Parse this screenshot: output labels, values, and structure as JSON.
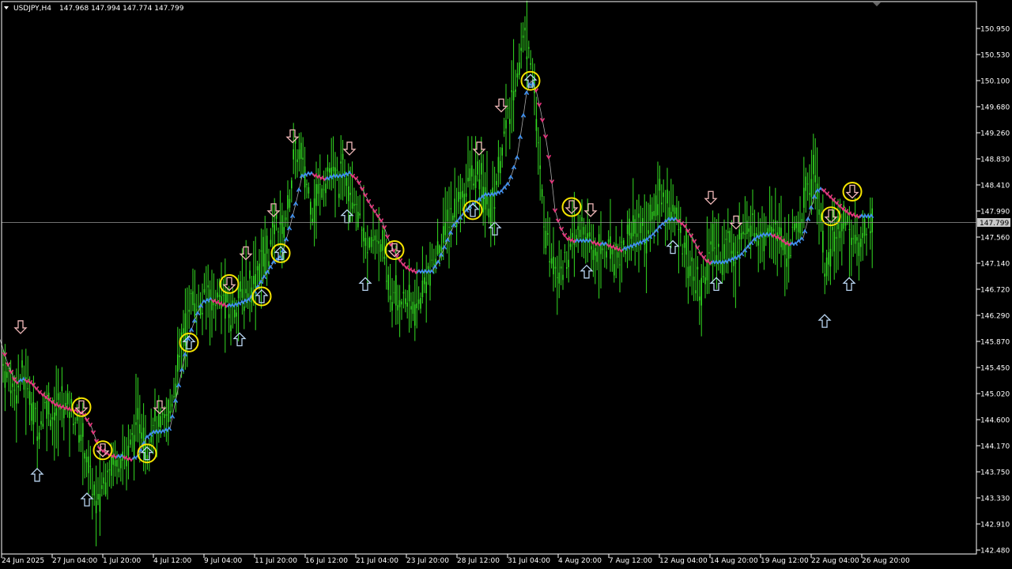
{
  "header": {
    "symbol": "USDJPY,H4",
    "ohlc": "147.968 147.994 147.774 147.799"
  },
  "colors": {
    "background": "#000000",
    "candle": "#33dd22",
    "axis": "#ffffff",
    "trend_up": "#3a8ef0",
    "trend_down": "#e8307a",
    "trail_line": "#aaaaaa",
    "arrow_up_outline": "#b8d4f0",
    "arrow_down_outline": "#f0b8b8",
    "circle": "#f5e300",
    "current_line": "#999999"
  },
  "chart_data": {
    "type": "candlestick",
    "symbol": "USDJPY",
    "timeframe": "H4",
    "current_price": 147.799,
    "current_price_label": "147.799",
    "ylim": [
      142.48,
      151.08
    ],
    "y_ticks": [
      "150.950",
      "150.530",
      "150.100",
      "149.680",
      "149.260",
      "148.830",
      "148.410",
      "147.990",
      "147.560",
      "147.140",
      "146.720",
      "146.290",
      "145.870",
      "145.450",
      "145.020",
      "144.600",
      "144.170",
      "143.750",
      "143.330",
      "142.910",
      "142.480"
    ],
    "x_ticks": [
      "24 Jun 2025",
      "27 Jun 04:00",
      "1 Jul 20:00",
      "4 Jul 12:00",
      "9 Jul 04:00",
      "11 Jul 20:00",
      "16 Jul 12:00",
      "21 Jul 04:00",
      "23 Jul 20:00",
      "28 Jul 12:00",
      "31 Jul 04:00",
      "4 Aug 20:00",
      "7 Aug 12:00",
      "12 Aug 04:00",
      "14 Aug 20:00",
      "19 Aug 12:00",
      "22 Aug 04:00",
      "26 Aug 20:00"
    ],
    "price_path": [
      [
        0,
        145.7
      ],
      [
        8,
        145.3
      ],
      [
        18,
        145.1
      ],
      [
        28,
        145.3
      ],
      [
        38,
        145.0
      ],
      [
        48,
        144.4
      ],
      [
        58,
        144.9
      ],
      [
        68,
        144.6
      ],
      [
        80,
        144.9
      ],
      [
        92,
        144.7
      ],
      [
        102,
        144.4
      ],
      [
        112,
        143.8
      ],
      [
        122,
        143.2
      ],
      [
        130,
        143.6
      ],
      [
        140,
        143.9
      ],
      [
        150,
        144.0
      ],
      [
        160,
        144.0
      ],
      [
        170,
        144.4
      ],
      [
        178,
        144.6
      ],
      [
        186,
        144.1
      ],
      [
        194,
        144.6
      ],
      [
        202,
        144.4
      ],
      [
        212,
        144.6
      ],
      [
        220,
        145.1
      ],
      [
        228,
        145.7
      ],
      [
        236,
        146.2
      ],
      [
        244,
        146.6
      ],
      [
        254,
        146.4
      ],
      [
        262,
        146.7
      ],
      [
        272,
        146.5
      ],
      [
        282,
        146.6
      ],
      [
        292,
        146.3
      ],
      [
        302,
        146.6
      ],
      [
        312,
        146.7
      ],
      [
        322,
        146.9
      ],
      [
        332,
        147.2
      ],
      [
        342,
        147.4
      ],
      [
        350,
        147.8
      ],
      [
        358,
        147.6
      ],
      [
        366,
        148.2
      ],
      [
        372,
        148.8
      ],
      [
        380,
        148.9
      ],
      [
        388,
        148.4
      ],
      [
        396,
        148.0
      ],
      [
        406,
        148.4
      ],
      [
        416,
        148.6
      ],
      [
        426,
        148.5
      ],
      [
        436,
        148.6
      ],
      [
        446,
        148.4
      ],
      [
        456,
        147.8
      ],
      [
        464,
        147.3
      ],
      [
        472,
        147.5
      ],
      [
        480,
        147.6
      ],
      [
        488,
        147.0
      ],
      [
        496,
        146.6
      ],
      [
        504,
        146.5
      ],
      [
        512,
        146.6
      ],
      [
        520,
        146.4
      ],
      [
        528,
        146.4
      ],
      [
        538,
        146.9
      ],
      [
        548,
        147.1
      ],
      [
        558,
        147.5
      ],
      [
        566,
        147.8
      ],
      [
        576,
        148.0
      ],
      [
        586,
        148.3
      ],
      [
        596,
        148.6
      ],
      [
        606,
        148.5
      ],
      [
        614,
        148.2
      ],
      [
        622,
        148.0
      ],
      [
        630,
        148.6
      ],
      [
        638,
        149.3
      ],
      [
        646,
        149.6
      ],
      [
        654,
        150.3
      ],
      [
        662,
        150.8
      ],
      [
        670,
        150.7
      ],
      [
        676,
        150.0
      ],
      [
        682,
        148.6
      ],
      [
        688,
        147.9
      ],
      [
        694,
        147.5
      ],
      [
        700,
        147.2
      ],
      [
        708,
        147.0
      ],
      [
        716,
        147.2
      ],
      [
        726,
        147.5
      ],
      [
        736,
        147.7
      ],
      [
        746,
        147.4
      ],
      [
        756,
        147.3
      ],
      [
        766,
        147.4
      ],
      [
        776,
        147.3
      ],
      [
        786,
        147.3
      ],
      [
        796,
        147.6
      ],
      [
        806,
        147.8
      ],
      [
        816,
        147.6
      ],
      [
        826,
        147.9
      ],
      [
        836,
        148.3
      ],
      [
        846,
        148.0
      ],
      [
        856,
        147.8
      ],
      [
        866,
        147.4
      ],
      [
        876,
        147.0
      ],
      [
        886,
        146.6
      ],
      [
        894,
        147.2
      ],
      [
        902,
        147.4
      ],
      [
        912,
        147.3
      ],
      [
        922,
        147.5
      ],
      [
        932,
        147.3
      ],
      [
        942,
        147.7
      ],
      [
        952,
        147.8
      ],
      [
        962,
        147.6
      ],
      [
        972,
        147.8
      ],
      [
        982,
        147.7
      ],
      [
        992,
        147.3
      ],
      [
        1002,
        147.5
      ],
      [
        1012,
        147.8
      ],
      [
        1020,
        148.3
      ],
      [
        1030,
        148.7
      ],
      [
        1038,
        147.9
      ],
      [
        1044,
        146.9
      ],
      [
        1052,
        147.4
      ],
      [
        1060,
        147.6
      ],
      [
        1068,
        147.9
      ],
      [
        1076,
        147.6
      ],
      [
        1084,
        147.4
      ],
      [
        1092,
        147.6
      ],
      [
        1100,
        147.8
      ],
      [
        1104,
        147.8
      ]
    ],
    "trail_path": [
      [
        0,
        145.9
      ],
      [
        10,
        145.5
      ],
      [
        20,
        145.2
      ],
      [
        30,
        145.25
      ],
      [
        40,
        145.2
      ],
      [
        50,
        145.05
      ],
      [
        60,
        144.95
      ],
      [
        70,
        144.85
      ],
      [
        80,
        144.8
      ],
      [
        95,
        144.75
      ],
      [
        105,
        144.7
      ],
      [
        115,
        144.5
      ],
      [
        125,
        144.15
      ],
      [
        135,
        144.05
      ],
      [
        145,
        144.0
      ],
      [
        155,
        144.0
      ],
      [
        165,
        143.95
      ],
      [
        175,
        144.0
      ],
      [
        185,
        144.3
      ],
      [
        195,
        144.4
      ],
      [
        205,
        144.4
      ],
      [
        215,
        144.45
      ],
      [
        222,
        144.9
      ],
      [
        230,
        145.4
      ],
      [
        238,
        145.9
      ],
      [
        246,
        146.2
      ],
      [
        256,
        146.5
      ],
      [
        266,
        146.55
      ],
      [
        276,
        146.5
      ],
      [
        286,
        146.45
      ],
      [
        296,
        146.45
      ],
      [
        306,
        146.5
      ],
      [
        316,
        146.55
      ],
      [
        326,
        146.75
      ],
      [
        336,
        146.95
      ],
      [
        346,
        147.15
      ],
      [
        356,
        147.25
      ],
      [
        366,
        147.7
      ],
      [
        374,
        148.1
      ],
      [
        382,
        148.55
      ],
      [
        392,
        148.6
      ],
      [
        402,
        148.55
      ],
      [
        412,
        148.5
      ],
      [
        422,
        148.55
      ],
      [
        432,
        148.55
      ],
      [
        442,
        148.6
      ],
      [
        452,
        148.5
      ],
      [
        460,
        148.3
      ],
      [
        468,
        148.1
      ],
      [
        476,
        147.95
      ],
      [
        484,
        147.8
      ],
      [
        492,
        147.5
      ],
      [
        500,
        147.3
      ],
      [
        508,
        147.15
      ],
      [
        516,
        147.05
      ],
      [
        526,
        147.0
      ],
      [
        536,
        147.0
      ],
      [
        546,
        147.0
      ],
      [
        554,
        147.15
      ],
      [
        564,
        147.45
      ],
      [
        574,
        147.75
      ],
      [
        584,
        147.9
      ],
      [
        594,
        148.05
      ],
      [
        604,
        148.15
      ],
      [
        614,
        148.25
      ],
      [
        624,
        148.25
      ],
      [
        634,
        148.3
      ],
      [
        644,
        148.45
      ],
      [
        654,
        148.85
      ],
      [
        660,
        149.35
      ],
      [
        666,
        149.9
      ],
      [
        672,
        150.1
      ],
      [
        678,
        149.95
      ],
      [
        684,
        149.6
      ],
      [
        690,
        149.2
      ],
      [
        696,
        148.7
      ],
      [
        702,
        148.0
      ],
      [
        708,
        147.75
      ],
      [
        716,
        147.55
      ],
      [
        726,
        147.5
      ],
      [
        736,
        147.5
      ],
      [
        746,
        147.5
      ],
      [
        756,
        147.45
      ],
      [
        766,
        147.45
      ],
      [
        776,
        147.4
      ],
      [
        786,
        147.35
      ],
      [
        796,
        147.4
      ],
      [
        806,
        147.45
      ],
      [
        816,
        147.5
      ],
      [
        826,
        147.6
      ],
      [
        836,
        147.75
      ],
      [
        846,
        147.85
      ],
      [
        856,
        147.85
      ],
      [
        866,
        147.75
      ],
      [
        876,
        147.55
      ],
      [
        886,
        147.3
      ],
      [
        896,
        147.15
      ],
      [
        906,
        147.15
      ],
      [
        916,
        147.15
      ],
      [
        926,
        147.2
      ],
      [
        936,
        147.25
      ],
      [
        946,
        147.4
      ],
      [
        956,
        147.55
      ],
      [
        966,
        147.6
      ],
      [
        976,
        147.6
      ],
      [
        986,
        147.55
      ],
      [
        996,
        147.45
      ],
      [
        1006,
        147.45
      ],
      [
        1016,
        147.55
      ],
      [
        1024,
        147.95
      ],
      [
        1032,
        148.3
      ],
      [
        1040,
        148.35
      ],
      [
        1048,
        148.25
      ],
      [
        1056,
        148.15
      ],
      [
        1064,
        148.05
      ],
      [
        1074,
        147.95
      ],
      [
        1084,
        147.9
      ],
      [
        1094,
        147.9
      ],
      [
        1104,
        147.9
      ]
    ],
    "signal_arrows": [
      {
        "dir": "down",
        "x": 26,
        "price": 146.1
      },
      {
        "dir": "up",
        "x": 47,
        "price": 143.7
      },
      {
        "dir": "up",
        "x": 110,
        "price": 143.3
      },
      {
        "dir": "down",
        "x": 202,
        "price": 144.8
      },
      {
        "dir": "up",
        "x": 303,
        "price": 145.9
      },
      {
        "dir": "down",
        "x": 311,
        "price": 147.3
      },
      {
        "dir": "down",
        "x": 346,
        "price": 148.0
      },
      {
        "dir": "down",
        "x": 370,
        "price": 149.2
      },
      {
        "dir": "up",
        "x": 439,
        "price": 147.9
      },
      {
        "dir": "down",
        "x": 442,
        "price": 149.0
      },
      {
        "dir": "up",
        "x": 462,
        "price": 146.8
      },
      {
        "dir": "down",
        "x": 606,
        "price": 149.0
      },
      {
        "dir": "up",
        "x": 626,
        "price": 147.7
      },
      {
        "dir": "down",
        "x": 634,
        "price": 149.7
      },
      {
        "dir": "up",
        "x": 742,
        "price": 147.0
      },
      {
        "dir": "down",
        "x": 747,
        "price": 148.0
      },
      {
        "dir": "up",
        "x": 851,
        "price": 147.4
      },
      {
        "dir": "down",
        "x": 899,
        "price": 148.2
      },
      {
        "dir": "up",
        "x": 906,
        "price": 146.8
      },
      {
        "dir": "down",
        "x": 931,
        "price": 147.8
      },
      {
        "dir": "up",
        "x": 1043,
        "price": 146.2
      },
      {
        "dir": "up",
        "x": 1074,
        "price": 146.8
      }
    ],
    "circled_signals": [
      {
        "dir": "down",
        "x": 103,
        "price": 144.8
      },
      {
        "dir": "down",
        "x": 130,
        "price": 144.1
      },
      {
        "dir": "up",
        "x": 186,
        "price": 144.05
      },
      {
        "dir": "up",
        "x": 239,
        "price": 145.85
      },
      {
        "dir": "down",
        "x": 290,
        "price": 146.8
      },
      {
        "dir": "up",
        "x": 331,
        "price": 146.6
      },
      {
        "dir": "up",
        "x": 355,
        "price": 147.3
      },
      {
        "dir": "down",
        "x": 499,
        "price": 147.35
      },
      {
        "dir": "up",
        "x": 598,
        "price": 148.0
      },
      {
        "dir": "up",
        "x": 671,
        "price": 150.1
      },
      {
        "dir": "down",
        "x": 723,
        "price": 148.05
      },
      {
        "dir": "down",
        "x": 1051,
        "price": 147.9
      },
      {
        "dir": "down",
        "x": 1078,
        "price": 148.3
      }
    ]
  }
}
